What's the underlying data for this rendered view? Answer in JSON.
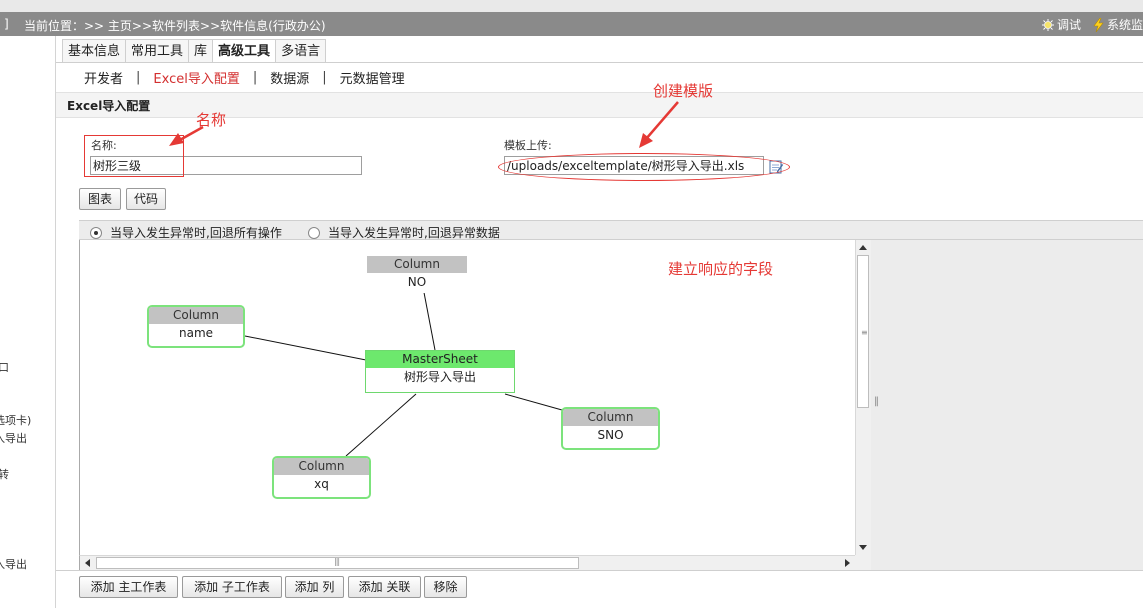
{
  "titlebar": {
    "lead": "]",
    "location": "当前位置：>> 主页>>软件列表>>软件信息(行政办公)",
    "tools": [
      {
        "label": "调试",
        "icon": "bug-icon"
      },
      {
        "label": "系统监",
        "icon": "lightning-icon"
      }
    ]
  },
  "left_panel": {
    "fragments": [
      "口",
      "选项卡)",
      "入导出",
      "转",
      "入导出"
    ]
  },
  "tabs": [
    {
      "label": "基本信息",
      "active": false
    },
    {
      "label": "常用工具",
      "active": false
    },
    {
      "label": "库",
      "active": false
    },
    {
      "label": "高级工具",
      "active": true
    },
    {
      "label": "多语言",
      "active": false
    }
  ],
  "subnav": [
    {
      "label": "开发者",
      "active": false
    },
    {
      "label": "Excel导入配置",
      "active": true
    },
    {
      "label": "数据源",
      "active": false
    },
    {
      "label": "元数据管理",
      "active": false
    }
  ],
  "subnav_separator": "|",
  "section_title": "Excel导入配置",
  "form": {
    "name_label": "名称:",
    "name_value": "树形三级",
    "template_label": "模板上传:",
    "template_value": "/uploads/exceltemplate/树形导入导出.xls"
  },
  "annotations": {
    "name": "名称",
    "create_template": "创建模版",
    "build_fields": "建立响应的字段",
    "color": "#e53935"
  },
  "view_buttons": {
    "chart": "图表",
    "code": "代码"
  },
  "options": [
    {
      "label": "当导入发生异常时,回退所有操作",
      "checked": true
    },
    {
      "label": "当导入发生异常时,回退异常数据",
      "checked": false
    }
  ],
  "diagram": {
    "header_label": "Column",
    "master_header": "MasterSheet",
    "master_value": "树形导入导出",
    "columns": [
      "NO",
      "name",
      "SNO",
      "xq"
    ],
    "node_border_color": "#7ce37c",
    "master_color": "#6de86d"
  },
  "scroll_grip": {
    "vertical": "≡",
    "horizontal": "|||",
    "splitter": "‖"
  },
  "actions": {
    "add_main_sheet": "添加 主工作表",
    "add_sub_sheet": "添加 子工作表",
    "add_column": "添加 列",
    "add_relation": "添加 关联",
    "remove": "移除"
  }
}
